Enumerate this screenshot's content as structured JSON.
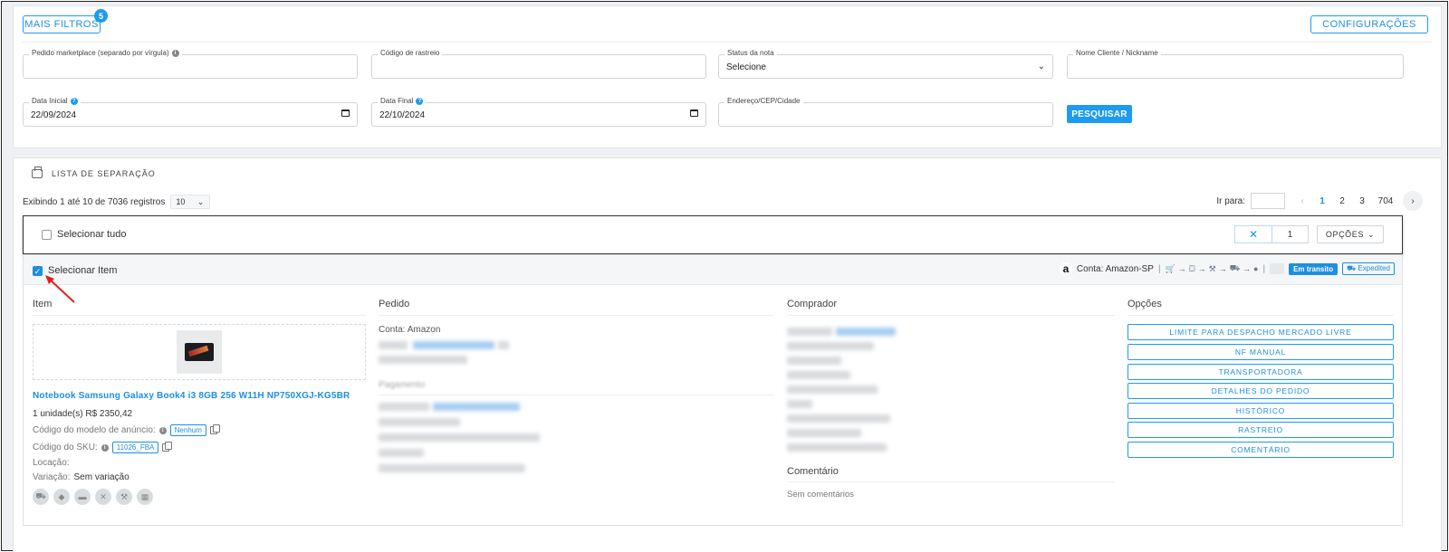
{
  "filters": {
    "more_filters_label": "MAIS FILTROS",
    "more_filters_count": "5",
    "settings_label": "CONFIGURAÇÕES",
    "fields": {
      "pedido_marketplace": {
        "label": "Pedido marketplace (separado por vírgula)",
        "value": ""
      },
      "codigo_rastreio": {
        "label": "Código de rastreio",
        "value": ""
      },
      "status_nota": {
        "label": "Status da nota",
        "value": "Selecione"
      },
      "nome_cliente": {
        "label": "Nome Cliente / Nickname",
        "value": ""
      },
      "data_inicial": {
        "label": "Data Inicial",
        "value": "22/09/2024"
      },
      "data_final": {
        "label": "Data Final",
        "value": "22/10/2024"
      },
      "endereco": {
        "label": "Endereço/CEP/Cidade",
        "value": ""
      }
    },
    "search_label": "PESQUISAR"
  },
  "list": {
    "title": "LISTA DE SEPARAÇÃO",
    "showing_text": "Exibindo 1 até 10 de 7036 registros",
    "per_page": "10",
    "goto_label": "Ir para:",
    "pages": [
      "1",
      "2",
      "3",
      "704"
    ],
    "current_page": "1"
  },
  "selection_bar": {
    "select_all_label": "Selecionar tudo",
    "quantity": "1",
    "options_label": "OPÇÕES"
  },
  "order": {
    "select_item_label": "Selecionar Item",
    "account_label": "Conta: Amazon-SP",
    "status_tag": "Em transito",
    "shipping_tag": "Expedited",
    "item_column": {
      "title": "Item",
      "product_name": "Notebook Samsung Galaxy Book4 i3 8GB 256 W11H NP750XGJ-KG5BR",
      "units_price": "1 unidade(s) R$ 2350,42",
      "model_code_label": "Código do modelo de anúncio:",
      "model_code_value": "Nenhum",
      "sku_label": "Código do SKU:",
      "sku_value": "11026_FBA",
      "location_label": "Locação:",
      "variation_label": "Variação:",
      "variation_value": "Sem variação"
    },
    "order_column": {
      "title": "Pedido",
      "account_line": "Conta:  Amazon",
      "payment_heading": "Pagamento"
    },
    "buyer_column": {
      "title": "Comprador",
      "comment_title": "Comentário",
      "comment_text": "Sem comentários"
    },
    "options_column": {
      "title": "Opções",
      "buttons": [
        "LIMITE PARA DESPACHO MERCADO LIVRE",
        "NF MANUAL",
        "TRANSPORTADORA",
        "DETALHES DO PEDIDO",
        "HISTÓRICO",
        "RASTREIO",
        "COMENTÁRIO"
      ]
    }
  },
  "colors": {
    "accent": "#1d9bf0",
    "link": "#1d8fe0",
    "annotation_arrow": "#e02020"
  }
}
